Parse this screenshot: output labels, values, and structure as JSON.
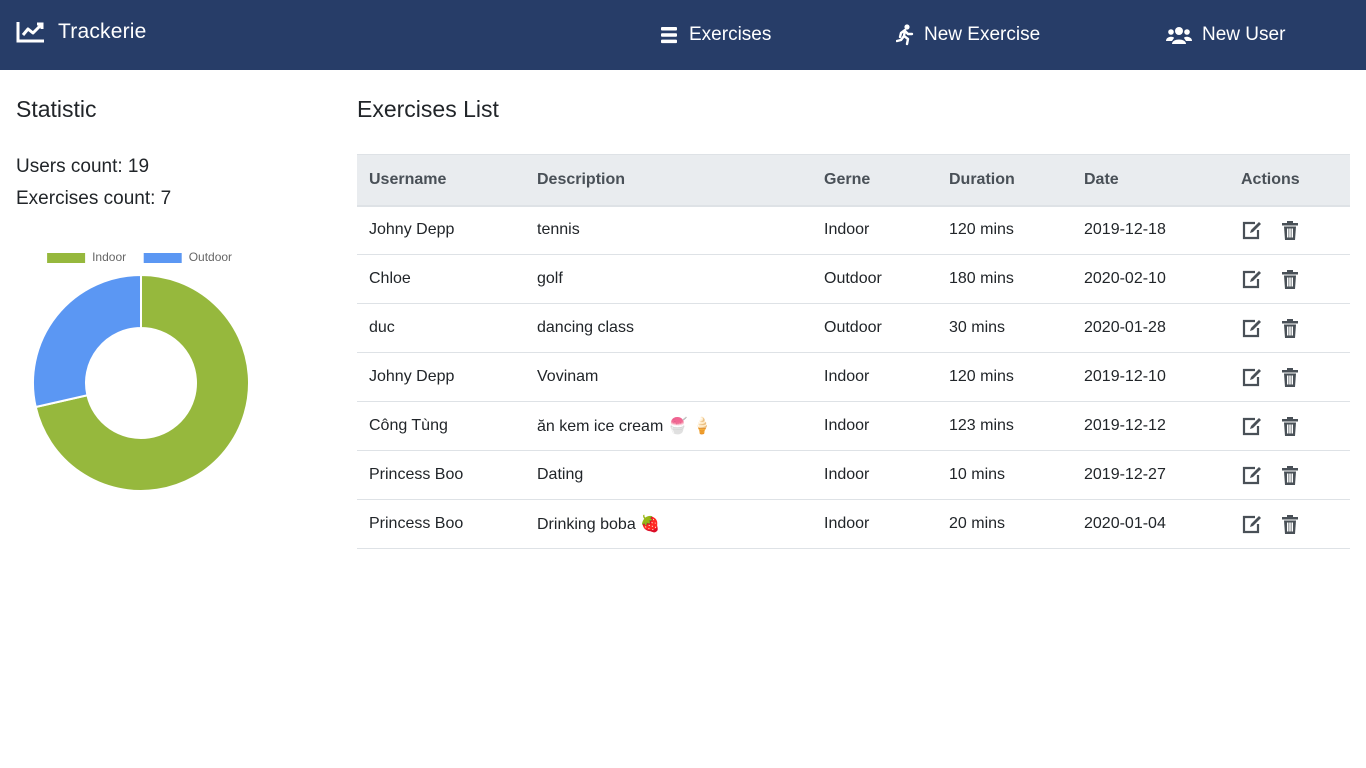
{
  "navbar": {
    "brand": "Trackerie",
    "brand_icon": "chart-line-icon",
    "background": "#273d68",
    "links": [
      {
        "label": "Exercises",
        "icon": "list-icon"
      },
      {
        "label": "New Exercise",
        "icon": "running-icon"
      },
      {
        "label": "New User",
        "icon": "users-icon"
      }
    ]
  },
  "statistic": {
    "title": "Statistic",
    "users_count": "Users count: 19",
    "exercises_count": "Exercises count: 7"
  },
  "chart_data": {
    "type": "pie",
    "variant": "doughnut",
    "categories": [
      "Indoor",
      "Outdoor"
    ],
    "values": [
      5,
      2
    ],
    "colors": [
      "#96b83d",
      "#5b97f3"
    ],
    "legend": "top"
  },
  "exercises": {
    "title": "Exercises List",
    "columns": [
      "Username",
      "Description",
      "Gerne",
      "Duration",
      "Date",
      "Actions"
    ],
    "action_icons": [
      "edit-icon",
      "trash-icon"
    ],
    "rows": [
      {
        "username": "Johny Depp",
        "description": "tennis",
        "genre": "Indoor",
        "duration": "120 mins",
        "date": "2019-12-18"
      },
      {
        "username": "Chloe",
        "description": "golf",
        "genre": "Outdoor",
        "duration": "180 mins",
        "date": "2020-02-10"
      },
      {
        "username": "duc",
        "description": "dancing class",
        "genre": "Outdoor",
        "duration": "30 mins",
        "date": "2020-01-28"
      },
      {
        "username": "Johny Depp",
        "description": "Vovinam",
        "genre": "Indoor",
        "duration": "120 mins",
        "date": "2019-12-10"
      },
      {
        "username": "Công Tùng",
        "description": "ăn kem ice cream 🍧 🍦",
        "genre": "Indoor",
        "duration": "123 mins",
        "date": "2019-12-12"
      },
      {
        "username": "Princess Boo",
        "description": "Dating",
        "genre": "Indoor",
        "duration": "10 mins",
        "date": "2019-12-27"
      },
      {
        "username": "Princess Boo",
        "description": "Drinking boba 🍓",
        "genre": "Indoor",
        "duration": "20 mins",
        "date": "2020-01-04"
      }
    ]
  }
}
